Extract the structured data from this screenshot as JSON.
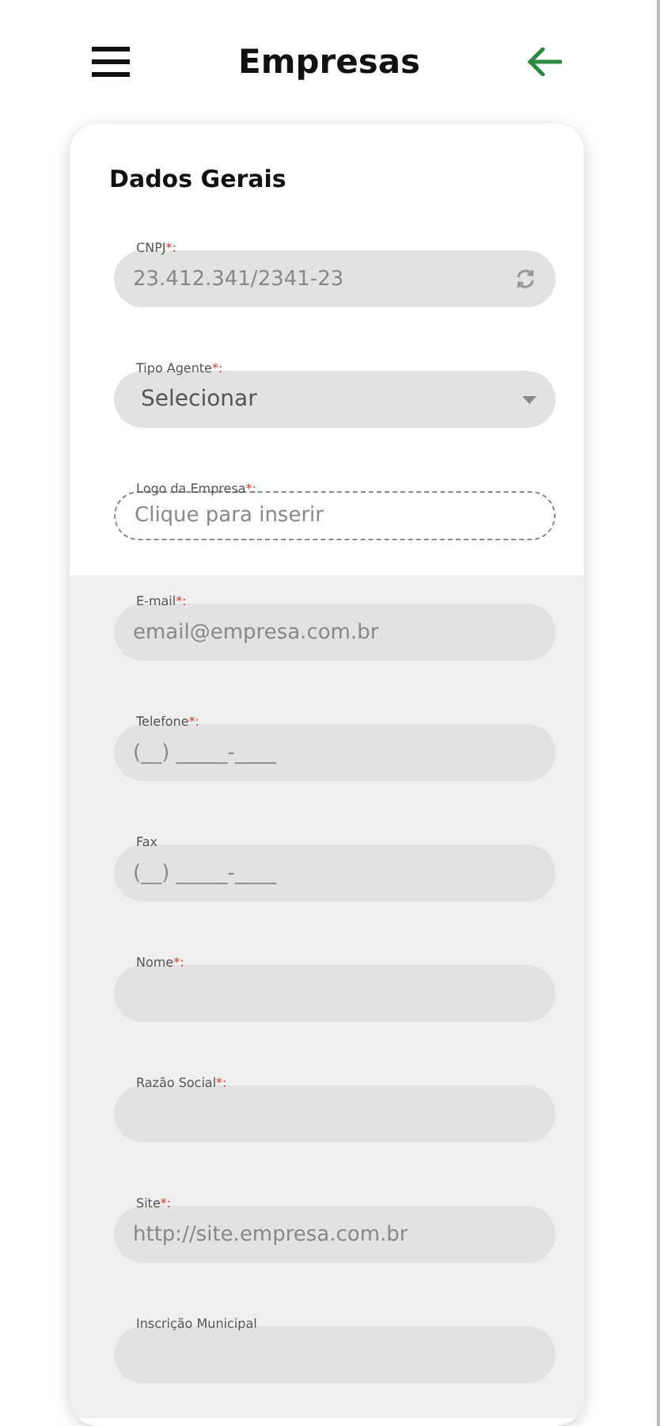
{
  "header": {
    "title": "Empresas"
  },
  "card": {
    "title": "Dados Gerais",
    "fields": [
      {
        "kind": "text",
        "label": "CNPJ",
        "mark": "*:",
        "value": "23.412.341/2341-23",
        "disabled": false
      },
      {
        "kind": "select",
        "label": "Tipo Agente",
        "mark": "*:",
        "value": "Selecionar",
        "disabled": false
      },
      {
        "kind": "upload",
        "label": "Logo da Empresa",
        "mark": "*:",
        "placeholder": "Clique para inserir",
        "disabled": false
      },
      {
        "kind": "text",
        "label": "E-mail",
        "mark": "*:",
        "placeholder": "email@empresa.com.br",
        "disabled": true
      },
      {
        "kind": "text",
        "label": "Telefone",
        "mark": "*:",
        "placeholder": "(__) _____-____",
        "disabled": true
      },
      {
        "kind": "text",
        "label": "Fax",
        "placeholder": "(__) _____-____",
        "disabled": true
      },
      {
        "kind": "text",
        "label": "Nome",
        "mark": "*:",
        "disabled": true
      },
      {
        "kind": "text",
        "label": "Razão Social",
        "mark": "*:",
        "disabled": true
      },
      {
        "kind": "text",
        "label": "Site",
        "mark": "*:",
        "placeholder": "http://site.empresa.com.br",
        "disabled": true
      },
      {
        "kind": "text",
        "label": "Inscrição Municipal",
        "disabled": true
      }
    ]
  }
}
